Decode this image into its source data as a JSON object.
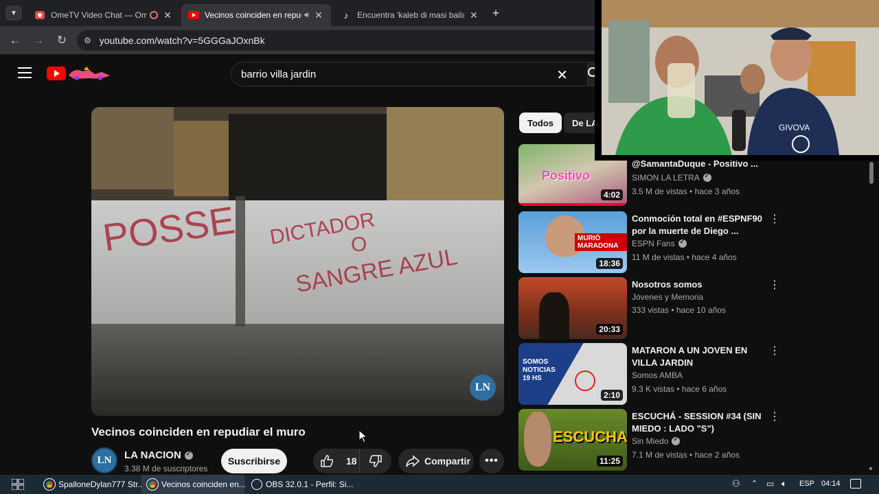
{
  "browser": {
    "tabs": [
      {
        "title": "OmeTV Video Chat — Ome",
        "icon": "ometv-icon"
      },
      {
        "title": "Vecinos coinciden en repud",
        "icon": "youtube-icon",
        "active": true
      },
      {
        "title": "Encuentra 'kaleb di masi baila n",
        "icon": "tiktok-icon"
      }
    ],
    "new_tab": "+",
    "url": "youtube.com/watch?v=5GGGaJOxnBk"
  },
  "youtube": {
    "search_query": "barrio villa jardin",
    "video": {
      "watermark": "LN",
      "title": "Vecinos coinciden en repudiar el muro",
      "channel": "LA NACION",
      "channel_avatar": "LN",
      "subscribers": "3.38 M de suscriptores",
      "subscribe_label": "Suscribirse",
      "likes": "18",
      "share_label": "Compartir",
      "graffiti": {
        "line1": "POSSE",
        "line2": "DICTADOR",
        "line3": "O",
        "line4": "SANGRE AZUL"
      }
    },
    "chips": [
      "Todos",
      "De LA"
    ],
    "recommendations": [
      {
        "title": "@SamantaDuque  - Positivo ...",
        "channel": "SIMON LA LETRA",
        "verified": true,
        "meta": "3.5 M de vistas • hace 3 años",
        "duration": "4:02",
        "thumb_text": "Positivo",
        "accent": "#c7336a"
      },
      {
        "title": "Conmoción total en #ESPNF90 por la muerte de Diego ...",
        "channel": "ESPN Fans",
        "verified": true,
        "meta": "11 M de vistas • hace 4 años",
        "duration": "18:36",
        "thumb_text": "MURIÓ MARADONA",
        "accent": "#c00000"
      },
      {
        "title": "Nosotros somos",
        "channel": "Jóvenes y Memoria",
        "verified": false,
        "meta": "333 vistas • hace 10 años",
        "duration": "20:33",
        "thumb_text": "",
        "accent": "#a93b1f"
      },
      {
        "title": "MATARON A UN JOVEN EN VILLA JARDIN",
        "channel": "Somos AMBA",
        "verified": false,
        "meta": "9.3 K vistas • hace 6 años",
        "duration": "2:10",
        "thumb_text": "SOMOS NOTICIAS 19 HS",
        "accent": "#1d3f8a"
      },
      {
        "title": "ESCUCHÁ - SESSION #34 (SIN MIEDO : LADO \"S\")",
        "channel": "Sin Miedo",
        "verified": true,
        "meta": "7.1 M de vistas • hace 2 años",
        "duration": "11:25",
        "thumb_text": "ESCUCHA",
        "accent": "#d4a21a"
      }
    ]
  },
  "webcam": {
    "shirt_text": "GIVOVA"
  },
  "taskbar": {
    "items": [
      {
        "label": "SpalloneDylan777 Str...",
        "icon": "chrome-icon"
      },
      {
        "label": "Vecinos coinciden en...",
        "icon": "chrome-icon",
        "active": true
      },
      {
        "label": "OBS 32.0.1 - Perfil: Si...",
        "icon": "obs-icon"
      }
    ],
    "lang": "ESP",
    "time": "04:14"
  },
  "colors": {
    "youtube_red": "#ff0000",
    "dark_bg": "#0f0f0f",
    "chip_active": "#f1f1f1"
  }
}
